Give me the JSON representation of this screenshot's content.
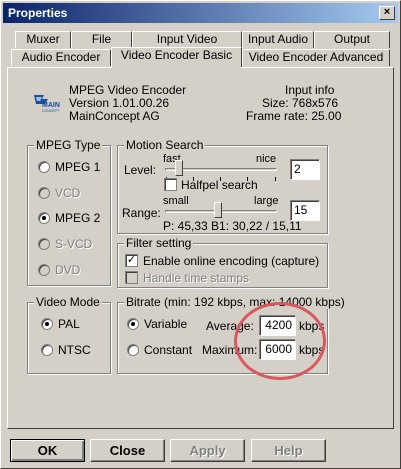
{
  "window": {
    "title": "Properties",
    "close_label": "×"
  },
  "tabs_row1": [
    "Muxer",
    "File",
    "Input Video",
    "Input Audio",
    "Output"
  ],
  "tabs_row2": [
    "Audio Encoder",
    "Video Encoder Basic",
    "Video Encoder Advanced"
  ],
  "active_tab": "Video Encoder Basic",
  "header": {
    "logo_text": "MAIN",
    "logo_sub": "CONCEPT",
    "product": "MPEG Video Encoder",
    "version": "Version 1.01.00.26",
    "company": "MainConcept AG",
    "info_title": "Input info",
    "size": "Size: 768x576",
    "frame_rate": "Frame rate: 25.00"
  },
  "mpeg_type": {
    "legend": "MPEG Type",
    "options": [
      {
        "label": "MPEG 1",
        "selected": false,
        "enabled": true
      },
      {
        "label": "VCD",
        "selected": false,
        "enabled": false
      },
      {
        "label": "MPEG 2",
        "selected": true,
        "enabled": true
      },
      {
        "label": "S-VCD",
        "selected": false,
        "enabled": false
      },
      {
        "label": "DVD",
        "selected": false,
        "enabled": false
      }
    ]
  },
  "motion_search": {
    "legend": "Motion Search",
    "level_label": "Level:",
    "level_min": "fast",
    "level_max": "nice",
    "level_value": "2",
    "halfpel_label": "Halfpel search",
    "halfpel_checked": false,
    "range_label": "Range:",
    "range_min": "small",
    "range_max": "large",
    "range_value": "15",
    "range_info": "P: 45,33   B1: 30,22 / 15,11"
  },
  "filter_setting": {
    "legend": "Filter setting",
    "online_label": "Enable online encoding (capture)",
    "online_checked": true,
    "timestamps_label": "Handle time stamps",
    "timestamps_checked": false
  },
  "video_mode": {
    "legend": "Video Mode",
    "options": [
      {
        "label": "PAL",
        "selected": true
      },
      {
        "label": "NTSC",
        "selected": false
      }
    ]
  },
  "bitrate": {
    "legend": "Bitrate (min: 192 kbps, max: 14000 kbps)",
    "variable_label": "Variable",
    "constant_label": "Constant",
    "selected": "Variable",
    "average_label": "Average:",
    "average_value": "4200",
    "maximum_label": "Maximum:",
    "maximum_value": "6000",
    "unit": "kbps"
  },
  "buttons": {
    "ok": "OK",
    "close": "Close",
    "apply": "Apply",
    "help": "Help"
  },
  "colors": {
    "title_start": "#0a246a",
    "title_end": "#a6caf0",
    "annotation": "#d9575e"
  }
}
